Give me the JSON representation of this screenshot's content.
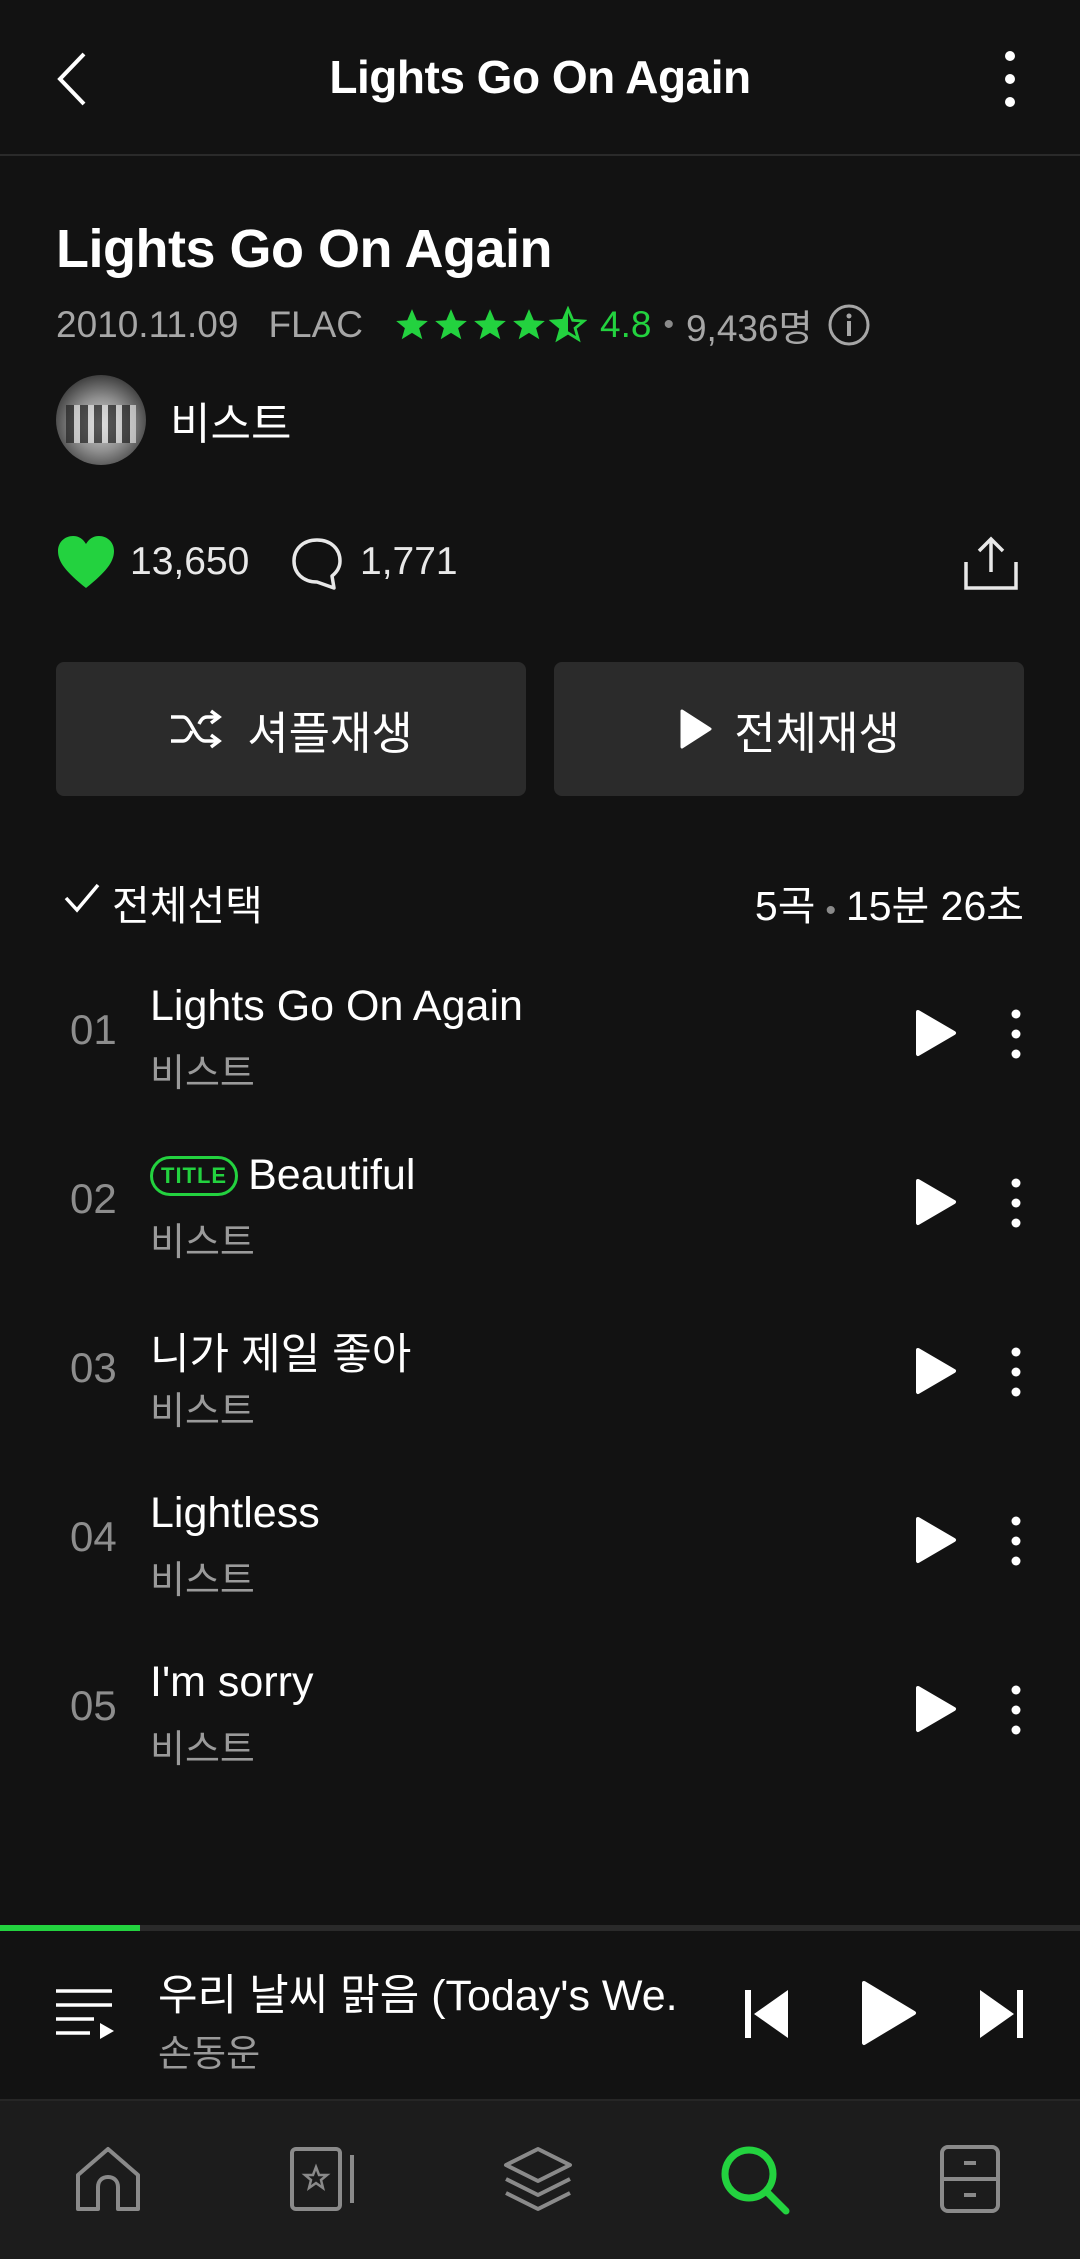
{
  "header": {
    "title": "Lights Go On Again"
  },
  "album": {
    "title": "Lights Go On Again",
    "release_date": "2010.11.09",
    "format": "FLAC",
    "rating": "4.8",
    "rating_value": 4.5,
    "raters": "9,436명",
    "artist": "비스트"
  },
  "stats": {
    "likes": "13,650",
    "comments": "1,771"
  },
  "actions": {
    "shuffle_label": "셔플재생",
    "play_all_label": "전체재생"
  },
  "tracklist": {
    "select_all_label": "전체선택",
    "track_count": "5곡",
    "total_duration": "15분 26초",
    "title_badge": "TITLE",
    "tracks": [
      {
        "num": "01",
        "title": "Lights Go On Again",
        "artist": "비스트",
        "is_title": false
      },
      {
        "num": "02",
        "title": "Beautiful",
        "artist": "비스트",
        "is_title": true
      },
      {
        "num": "03",
        "title": "니가 제일 좋아",
        "artist": "비스트",
        "is_title": false
      },
      {
        "num": "04",
        "title": "Lightless",
        "artist": "비스트",
        "is_title": false
      },
      {
        "num": "05",
        "title": "I'm sorry",
        "artist": "비스트",
        "is_title": false
      }
    ]
  },
  "now_playing": {
    "title": "우리 날씨 맑음 (Today's We...",
    "artist": "손동운",
    "progress": 0.13
  },
  "colors": {
    "accent": "#23d23f",
    "background": "#121212",
    "button_bg": "#2b2b2b",
    "nav_bg": "#1c1c1c"
  },
  "icons": {
    "nav": [
      "home-icon",
      "library-icon",
      "layers-icon",
      "search-icon",
      "storage-icon"
    ],
    "active_nav": "search-icon"
  }
}
